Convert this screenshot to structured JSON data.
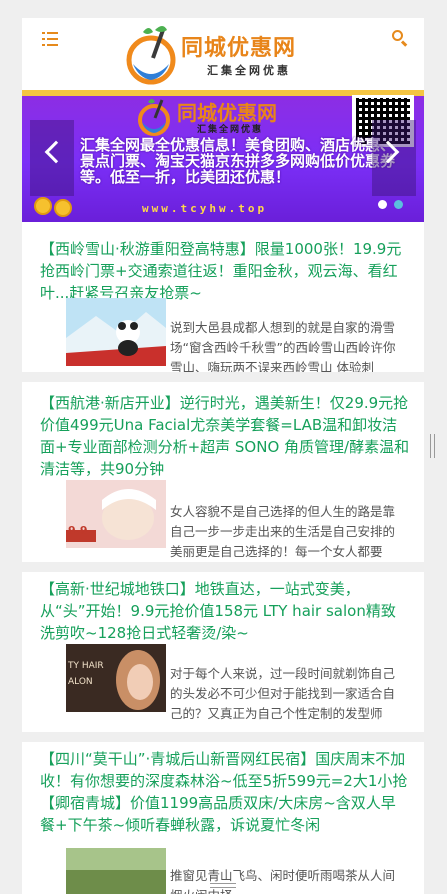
{
  "header": {
    "logo_title": "同城优惠网",
    "logo_subtitle": "汇集全网优惠",
    "menu_icon": "menu-icon",
    "search_icon": "search-icon",
    "accent_color": "#e8851a"
  },
  "banner": {
    "logo_title": "同城优惠网",
    "logo_subtitle": "汇集全网优惠",
    "text": "汇集全网最全优惠信息！美食团购、酒店优惠、景点门票、淘宝天猫京东拼多多网购低价优惠券等。低至一折，比美团还优惠！",
    "url": "www.tcyhw.top",
    "slide_count": 2,
    "active_slide": 2
  },
  "articles": [
    {
      "title": "【西岭雪山·秋游重阳登高特惠】限量1000张！19.9元抢西岭门票+交通索道往返！重阳金秋，观云海、看红叶...赶紧号召亲友抢票~",
      "summary": "说到大邑县成都人想到的就是自家的滑雪场“窗含西岭千秋雪”的西岭雪山西岭许你雪山、嗨玩两不误来西岭雪山 体验刺"
    },
    {
      "title": "【西航港·新店开业】逆行时光，遇美新生！仅29.9元抢价值499元Una Facial尤奈美学套餐=LAB温和卸妆洁面+专业面部检测分析+超声 SONO 角质管理/酵素温和清洁等，共90分钟",
      "summary": "女人容貌不是自己选择的但人生的路是靠自己一步一步走出来的生活是自己安排的　　美丽更是自己选择的！每一个女人都要"
    },
    {
      "title": "【高新·世纪城地铁口】地铁直达，一站式变美，从“头”开始！9.9元抢价值158元 LTY hair salon精致洗剪吹~128抢日式轻奢烫/染~",
      "summary": "对于每个人来说，过一段时间就剃饰自己的头发必不可少但对于能找到一家适合自己的？又真正为自己个性定制的发型师"
    },
    {
      "title": "【四川“莫干山”·青城后山新晋网红民宿】国庆周末不加收！有你想要的深度森林浴~低至5折599元=2大1小抢【卿宿青城】价值1199高品质双床/大床房~含双人早餐+下午茶~倾听春蝉秋露，诉说夏忙冬闲",
      "summary": "推窗见青山飞鸟、闲时便听雨喝茶从人间烟火闹中择一"
    }
  ],
  "thumb_labels": {
    "t2": "9.9",
    "t3": "TY HAIR ALON"
  }
}
